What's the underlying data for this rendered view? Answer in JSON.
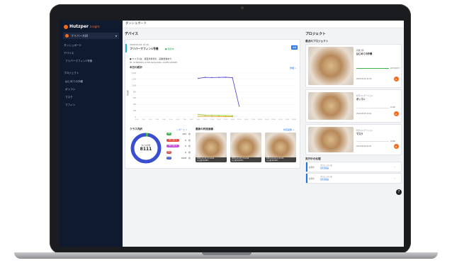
{
  "sidebar": {
    "logo": "Hutzper",
    "logo_sub": "Insight",
    "org_name": "フリバーネ研",
    "nav": [
      {
        "label": "ダッシュボード",
        "icon": "grid-icon"
      },
      {
        "label": "デバイス",
        "icon": "device-icon"
      },
      {
        "label": "フリバーマフィン1号機",
        "icon": ""
      },
      {
        "label": "プロジェクト",
        "icon": "folder-icon"
      },
      {
        "label": "はじめての外観",
        "icon": ""
      },
      {
        "label": "ボッコン",
        "icon": ""
      },
      {
        "label": "マスク",
        "icon": ""
      },
      {
        "label": "マフィン",
        "icon": ""
      }
    ]
  },
  "topbar": {
    "title": "ダッシュボード"
  },
  "devices": {
    "section_title": "デバイス",
    "device_date": "2024/12/29 13:10",
    "device_name": "フリバーマフィン1号機",
    "device_status": "● 接続中",
    "detail_button": "詳細",
    "note1": "● カメラ1台、検査対象待ち、画像送信あり",
    "note2": "ID: 0cb60b61-2c06-4e1a-b0bc-cbdf5ca3d0f2",
    "chart_title": "本日の統計",
    "chart_link": "詳細 >",
    "y_label": "検査数"
  },
  "chart_data": {
    "type": "line",
    "x": [
      "0:00",
      "1:00",
      "2:00",
      "3:00",
      "4:00",
      "5:00",
      "6:00",
      "7:00",
      "8:00",
      "9:00",
      "10:00",
      "11:00",
      "12:00",
      "13:00",
      "14:00",
      "15:00",
      "16:00",
      "17:00",
      "18:00",
      "19:00",
      "20:00",
      "21:00",
      "22:00",
      "23:00"
    ],
    "ylim": [
      0,
      1400
    ],
    "yticks": [
      "1,400",
      "1,200",
      "1,000",
      "800",
      "600",
      "400",
      "200",
      "0"
    ],
    "series": [
      {
        "color": "#5b4fcf",
        "values": [
          null,
          null,
          null,
          null,
          null,
          null,
          null,
          null,
          null,
          1230,
          1260,
          1255,
          1260,
          1265,
          1250,
          null,
          null,
          null,
          null,
          null,
          null,
          null,
          null,
          null
        ],
        "drop": [
          14,
          15,
          320
        ]
      },
      {
        "color": "#9bcf3a",
        "values": [
          null,
          null,
          null,
          null,
          null,
          null,
          null,
          null,
          null,
          80,
          60,
          55,
          50,
          45,
          40,
          null,
          null,
          null,
          null,
          null,
          null,
          null,
          null,
          null
        ]
      },
      {
        "color": "#e0a020",
        "values": [
          null,
          null,
          null,
          null,
          null,
          null,
          null,
          null,
          null,
          20,
          20,
          15,
          15,
          10,
          10,
          null,
          null,
          null,
          null,
          null,
          null,
          null,
          null,
          null
        ]
      }
    ]
  },
  "class_breakdown": {
    "title": "クラス内訳",
    "report_link": "レポート >",
    "donut_label": "本日の総数",
    "donut_value": "8111",
    "rows": [
      {
        "chip": "OK",
        "color": "#39b54a",
        "value": "183"
      },
      {
        "chip": "NG (欠け)",
        "color": "#e04a3f",
        "value": "0"
      },
      {
        "chip": "NG (焦げ)",
        "color": "#c24fd6",
        "value": "0"
      },
      {
        "chip": "NG",
        "color": "#e04a3f",
        "value": "0"
      },
      {
        "chip": "その他",
        "color": "#3a4fd0",
        "value": "7928"
      }
    ],
    "unit": "枚",
    "donut_segments": [
      {
        "fraction": 0.0226,
        "color": "#39b54a"
      },
      {
        "fraction": 0.9774,
        "color": "#3a4fd0"
      }
    ]
  },
  "latest_images": {
    "title": "最新の判定画像",
    "link": "判定画像 >",
    "captions": [
      {
        "line1": "2024-12-29 13:10:04",
        "line2": "その他 99.88%"
      },
      {
        "line1": "2024-12-29 13:10:04",
        "line2": "その他 99.83%"
      },
      {
        "line1": "2024-12-29 13:10:03",
        "line2": "その他 99.90%"
      }
    ]
  },
  "projects": {
    "section_title": "プロジェクト",
    "recent_title": "最近のプロジェクト",
    "items": [
      {
        "type": "画像分類",
        "name": "はじめての外観",
        "count": "2072/2072",
        "date": "2024-09-02 22:30",
        "progress": 1.0
      },
      {
        "type": "セグメンテーション",
        "name": "ボッコン",
        "count": "0/140",
        "date": "2024-06-05 10:21",
        "progress": 0.0
      },
      {
        "type": "セグメンテーション",
        "name": "マスク",
        "count": "0/346",
        "date": "2024-06-05 09:21",
        "progress": 0.0
      }
    ],
    "running_title": "実行中の処理",
    "running": [
      {
        "status": "処理中",
        "project_label": "プロジェクト名",
        "project": "自社製品"
      },
      {
        "status": "処理中",
        "project_label": "プロジェクト名",
        "project": "自社製品"
      }
    ]
  },
  "help": "?"
}
